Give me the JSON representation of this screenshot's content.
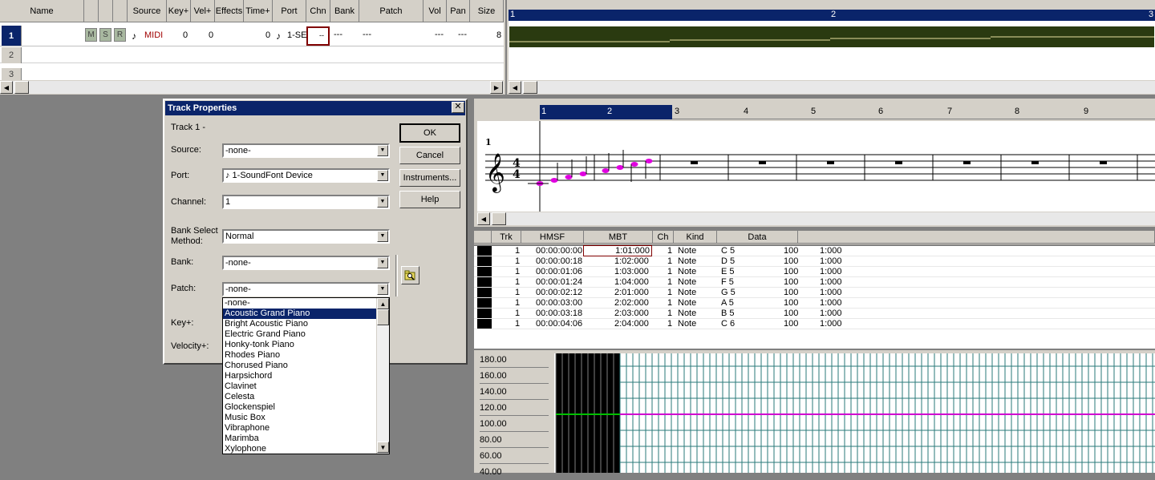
{
  "track_view": {
    "columns": [
      "Name",
      "Source",
      "Key+",
      "Vel+",
      "Effects",
      "Time+",
      "Port",
      "Chn",
      "Bank",
      "Patch",
      "Vol",
      "Pan",
      "Size"
    ],
    "msr": [
      "M",
      "S",
      "R"
    ],
    "rows": [
      {
        "num": "1",
        "source": "MIDI",
        "key": "0",
        "vel": "0",
        "time": "0",
        "port": "1-SE",
        "chn": "--",
        "bank": "---",
        "patch": "---",
        "vol": "---",
        "pan": "---",
        "size": "8"
      },
      {
        "num": "2"
      },
      {
        "num": "3"
      }
    ]
  },
  "clip_view": {
    "ruler": [
      "1",
      "2",
      "3"
    ]
  },
  "dialog": {
    "title": "Track Properties",
    "track_label": "Track 1 -",
    "source_label": "Source:",
    "source_value": "-none-",
    "port_label": "Port:",
    "port_value": "♪ 1-SoundFont Device",
    "channel_label": "Channel:",
    "channel_value": "1",
    "bank_method_label": "Bank Select\nMethod:",
    "bank_method_value": "Normal",
    "bank_label": "Bank:",
    "bank_value": "-none-",
    "patch_label": "Patch:",
    "patch_value": "-none-",
    "key_label": "Key+:",
    "velocity_label": "Velocity+:",
    "ok": "OK",
    "cancel": "Cancel",
    "instruments": "Instruments...",
    "help": "Help",
    "patch_list": [
      "-none-",
      "Acoustic Grand Piano",
      "Bright Acoustic Piano",
      "Electric Grand Piano",
      "Honky-tonk Piano",
      "Rhodes Piano",
      "Chorused Piano",
      "Harpsichord",
      "Clavinet",
      "Celesta",
      "Glockenspiel",
      "Music Box",
      "Vibraphone",
      "Marimba",
      "Xylophone"
    ],
    "patch_selected_index": 1
  },
  "staff_view": {
    "ruler": [
      "1",
      "2",
      "3",
      "4",
      "5",
      "6",
      "7",
      "8",
      "9"
    ],
    "track_number": "1",
    "time_sig_top": "4",
    "time_sig_bottom": "4"
  },
  "event_list": {
    "columns": [
      "Trk",
      "HMSF",
      "MBT",
      "Ch",
      "Kind",
      "Data"
    ],
    "rows": [
      {
        "trk": "1",
        "hmsf": "00:00:00:00",
        "mbt": "1:01:000",
        "ch": "1",
        "kind": "Note",
        "note": "C 5",
        "vel": "100",
        "dur": "1:000"
      },
      {
        "trk": "1",
        "hmsf": "00:00:00:18",
        "mbt": "1:02:000",
        "ch": "1",
        "kind": "Note",
        "note": "D 5",
        "vel": "100",
        "dur": "1:000"
      },
      {
        "trk": "1",
        "hmsf": "00:00:01:06",
        "mbt": "1:03:000",
        "ch": "1",
        "kind": "Note",
        "note": "E 5",
        "vel": "100",
        "dur": "1:000"
      },
      {
        "trk": "1",
        "hmsf": "00:00:01:24",
        "mbt": "1:04:000",
        "ch": "1",
        "kind": "Note",
        "note": "F 5",
        "vel": "100",
        "dur": "1:000"
      },
      {
        "trk": "1",
        "hmsf": "00:00:02:12",
        "mbt": "2:01:000",
        "ch": "1",
        "kind": "Note",
        "note": "G 5",
        "vel": "100",
        "dur": "1:000"
      },
      {
        "trk": "1",
        "hmsf": "00:00:03:00",
        "mbt": "2:02:000",
        "ch": "1",
        "kind": "Note",
        "note": "A 5",
        "vel": "100",
        "dur": "1:000"
      },
      {
        "trk": "1",
        "hmsf": "00:00:03:18",
        "mbt": "2:03:000",
        "ch": "1",
        "kind": "Note",
        "note": "B 5",
        "vel": "100",
        "dur": "1:000"
      },
      {
        "trk": "1",
        "hmsf": "00:00:04:06",
        "mbt": "2:04:000",
        "ch": "1",
        "kind": "Note",
        "note": "C 6",
        "vel": "100",
        "dur": "1:000"
      }
    ]
  },
  "controller_view": {
    "y_labels": [
      "180.00",
      "160.00",
      "140.00",
      "120.00",
      "100.00",
      "80.00",
      "60.00",
      "40.00"
    ],
    "line_value": "100.00",
    "line_color": "#d000d0",
    "active_color": "#00c000"
  }
}
